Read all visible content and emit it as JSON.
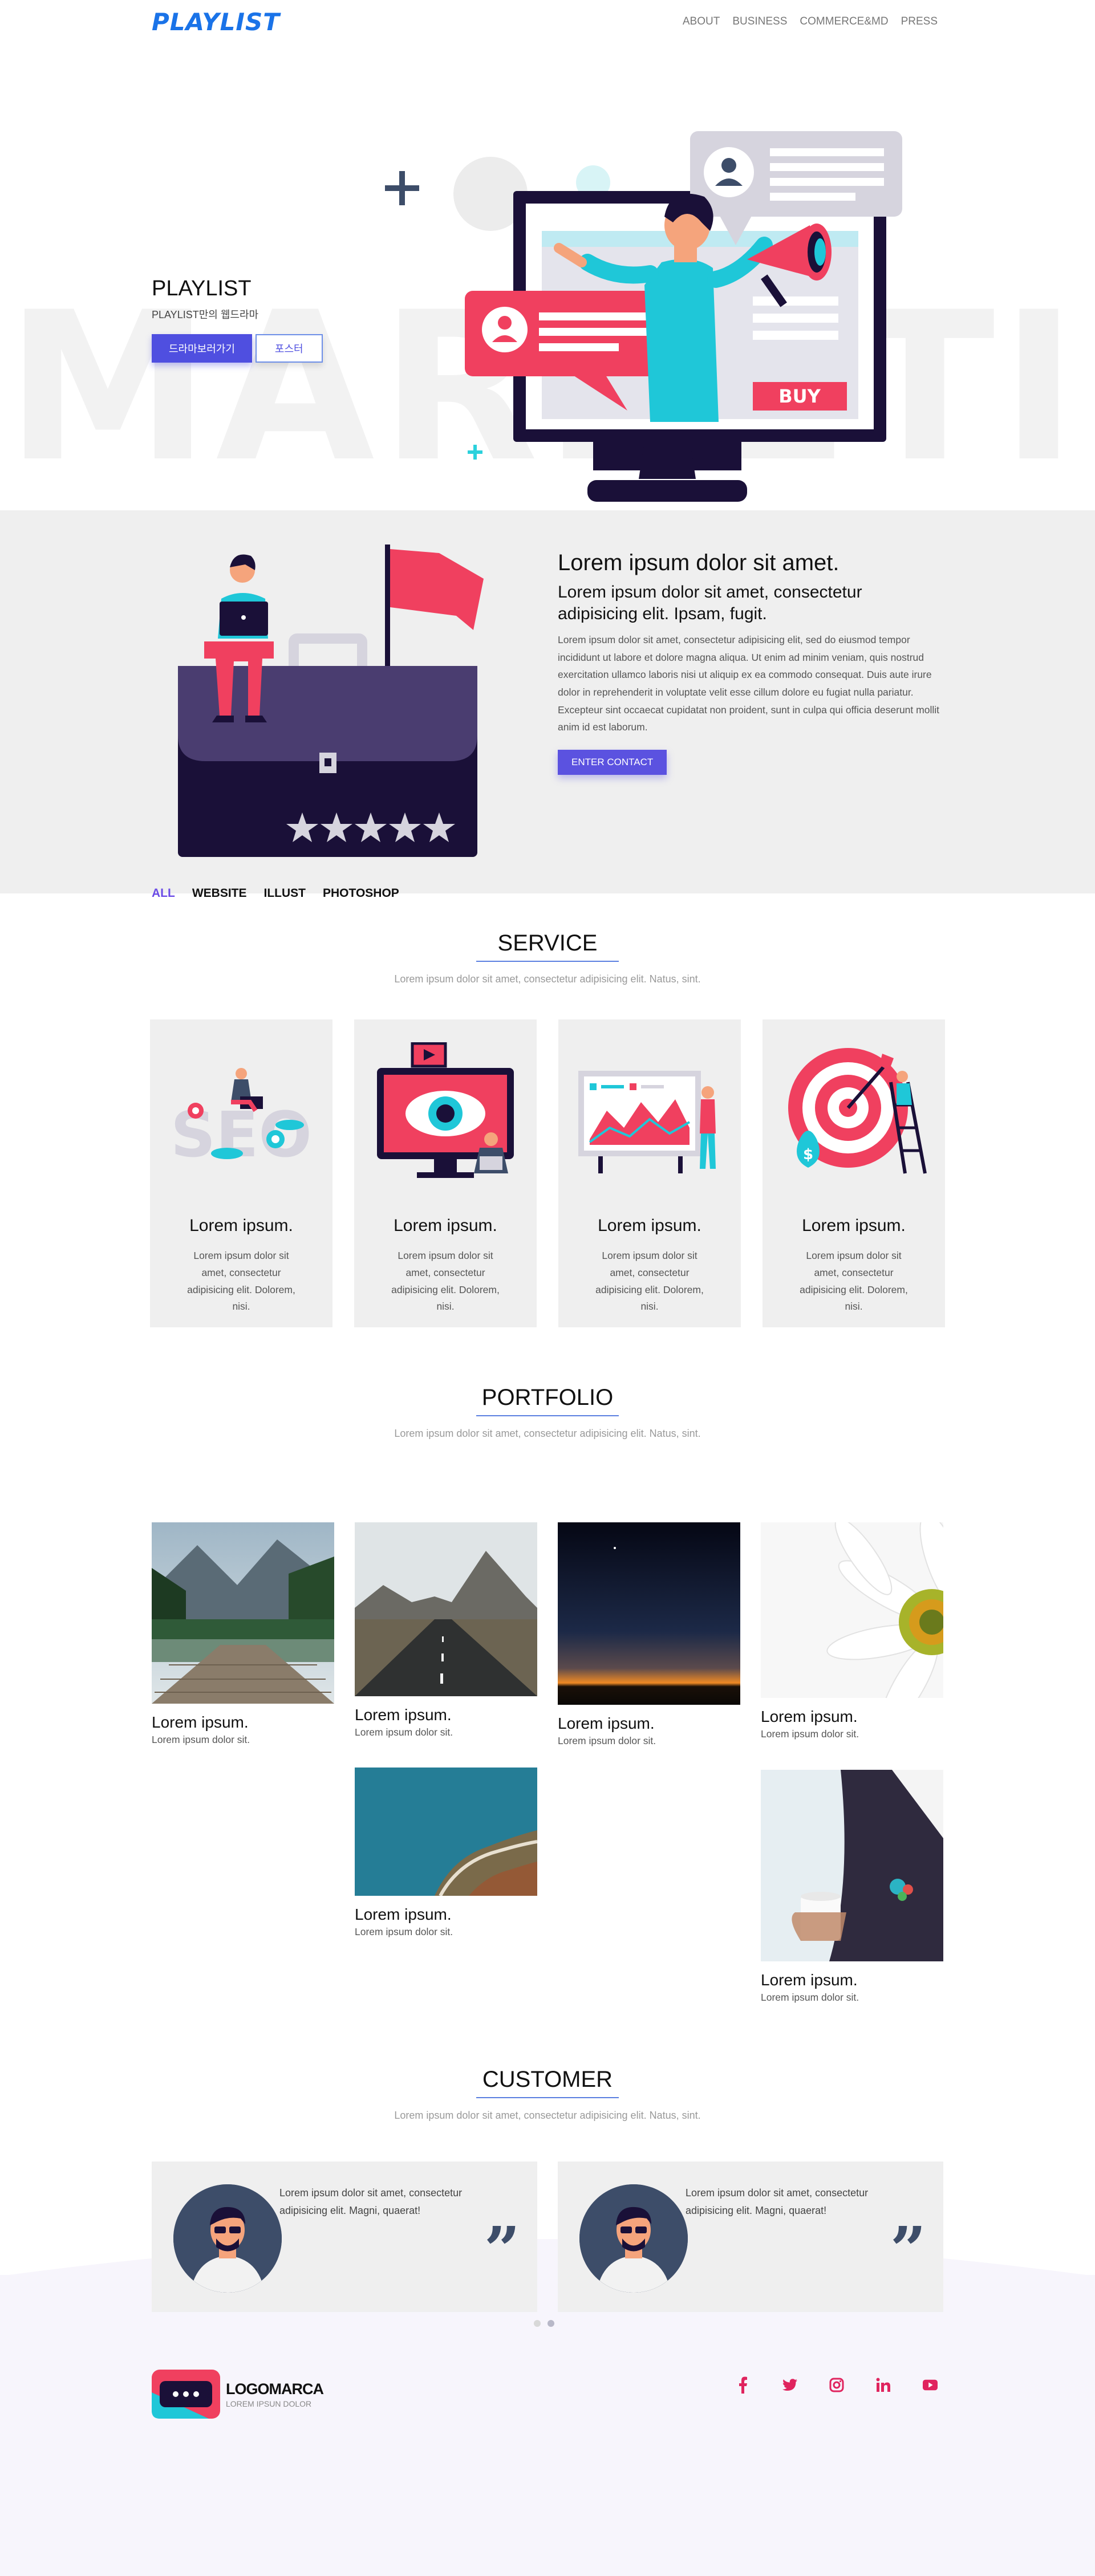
{
  "header": {
    "logo": "PLAYLIST",
    "nav": [
      "ABOUT",
      "BUSINESS",
      "COMMERCE&MD",
      "PRESS"
    ]
  },
  "hero": {
    "bg_word": "MARKETING",
    "title": "PLAYLIST",
    "subtitle": "PLAYLIST만의 웹드라마",
    "btn_primary": "드라마보러가기",
    "btn_outline": "포스터",
    "buy_label": "BUY"
  },
  "about": {
    "heading": "Lorem ipsum dolor sit amet.",
    "subheading": "Lorem ipsum dolor sit amet, consectetur adipisicing elit. Ipsam, fugit.",
    "paragraph": "Lorem ipsum dolor sit amet, consectetur adipisicing elit, sed do eiusmod tempor incididunt ut labore et dolore magna aliqua. Ut enim ad minim veniam, quis nostrud exercitation ullamco laboris nisi ut aliquip ex ea commodo consequat. Duis aute irure dolor in reprehenderit in voluptate velit esse cillum dolore eu fugiat nulla pariatur. Excepteur sint occaecat cupidatat non proident, sunt in culpa qui officia deserunt mollit anim id est laborum.",
    "button": "ENTER CONTACT"
  },
  "service": {
    "title": "SERVICE",
    "subtitle": "Lorem ipsum dolor sit amet, consectetur adipisicing elit. Natus, sint.",
    "cards": [
      {
        "title": "Lorem ipsum.",
        "text": "Lorem ipsum dolor sit amet, consectetur adipisicing elit. Dolorem, nisi.",
        "icon": "seo-icon"
      },
      {
        "title": "Lorem ipsum.",
        "text": "Lorem ipsum dolor sit amet, consectetur adipisicing elit. Dolorem, nisi.",
        "icon": "video-eye-icon"
      },
      {
        "title": "Lorem ipsum.",
        "text": "Lorem ipsum dolor sit amet, consectetur adipisicing elit. Dolorem, nisi.",
        "icon": "analytics-board-icon"
      },
      {
        "title": "Lorem ipsum.",
        "text": "Lorem ipsum dolor sit amet, consectetur adipisicing elit. Dolorem, nisi.",
        "icon": "target-icon"
      }
    ]
  },
  "portfolio": {
    "title": "PORTFOLIO",
    "subtitle": "Lorem ipsum dolor sit amet, consectetur adipisicing elit. Natus, sint.",
    "filters": [
      "ALL",
      "WEBSITE",
      "ILLUST",
      "PHOTOSHOP"
    ],
    "active_filter": "ALL",
    "items": [
      {
        "title": "Lorem ipsum.",
        "sub": "Lorem ipsum dolor sit.",
        "image": "lake-pier-photo"
      },
      {
        "title": "Lorem ipsum.",
        "sub": "Lorem ipsum dolor sit.",
        "image": "mountain-road-photo"
      },
      {
        "title": "Lorem ipsum.",
        "sub": "Lorem ipsum dolor sit.",
        "image": "night-horizon-photo"
      },
      {
        "title": "Lorem ipsum.",
        "sub": "Lorem ipsum dolor sit.",
        "image": "daisy-flower-photo"
      },
      {
        "title": "Lorem ipsum.",
        "sub": "Lorem ipsum dolor sit.",
        "image": "coastline-aerial-photo"
      },
      {
        "title": "Lorem ipsum.",
        "sub": "Lorem ipsum dolor sit.",
        "image": "suit-coffee-photo"
      }
    ]
  },
  "customer": {
    "title": "CUSTOMER",
    "subtitle": "Lorem ipsum dolor sit amet, consectetur adipisicing elit. Natus, sint.",
    "testimonials": [
      {
        "text": "Lorem ipsum dolor sit amet, consectetur adipisicing elit. Magni, quaerat!"
      },
      {
        "text": "Lorem ipsum dolor sit amet, consectetur adipisicing elit. Magni, quaerat!"
      }
    ],
    "quote_mark": "”"
  },
  "footer": {
    "logo_name": "LOGOMARCA",
    "logo_tag": "LOREM IPSUN DOLOR",
    "socials": [
      "facebook-icon",
      "twitter-icon",
      "instagram-icon",
      "linkedin-icon",
      "youtube-icon"
    ]
  },
  "colors": {
    "brand_blue": "#1a73e8",
    "accent_purple": "#4f4fe0",
    "pink": "#f0405f",
    "teal": "#1fc7d8",
    "navy": "#1a1038"
  }
}
